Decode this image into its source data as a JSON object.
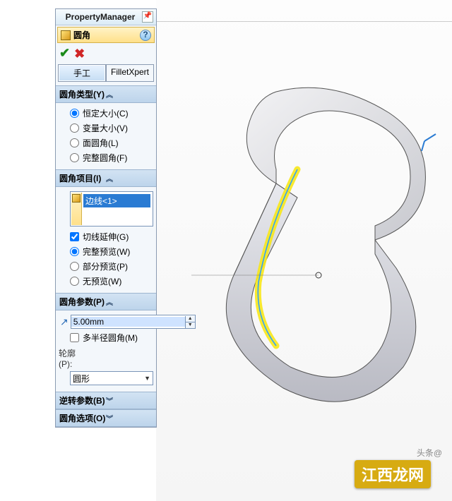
{
  "panel": {
    "title": "PropertyManager",
    "feature": "圆角",
    "modes": [
      "手工",
      "FilletXpert"
    ]
  },
  "sections": {
    "type": {
      "title": "圆角类型(Y)",
      "options": [
        "恒定大小(C)",
        "变量大小(V)",
        "面圆角(L)",
        "完整圆角(F)"
      ]
    },
    "items": {
      "title": "圆角项目(I)",
      "selected": [
        "边线<1>"
      ],
      "tangent": "切线延伸(G)",
      "preview": [
        "完整预览(W)",
        "部分预览(P)",
        "无预览(W)"
      ]
    },
    "params": {
      "title": "圆角参数(P)",
      "radius": "5.00mm",
      "multiRadius": "多半径圆角(M)",
      "profileLabel": "轮廓(P):",
      "profile": "圆形"
    },
    "setback": {
      "title": "逆转参数(B)"
    },
    "options": {
      "title": "圆角选项(O)"
    }
  },
  "footer": {
    "credit": "头条@",
    "watermark": "江西龙网"
  }
}
